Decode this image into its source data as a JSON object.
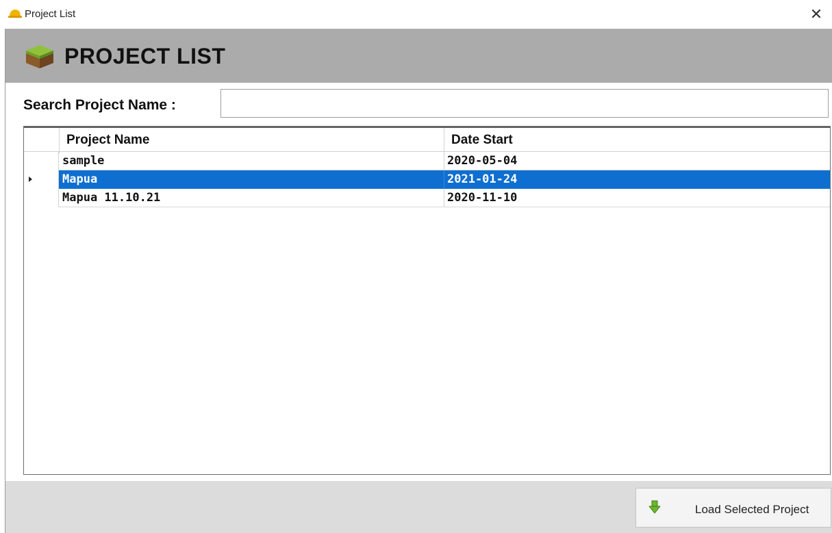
{
  "window": {
    "title": "Project List",
    "close_glyph": "✕"
  },
  "banner": {
    "title": "PROJECT LIST"
  },
  "search": {
    "label": "Search Project Name :",
    "value": "",
    "placeholder": ""
  },
  "grid": {
    "columns": [
      "Project Name",
      "Date Start"
    ],
    "rows": [
      {
        "name": "sample",
        "date": "2020-05-04",
        "selected": false
      },
      {
        "name": "Mapua",
        "date": "2021-01-24",
        "selected": true
      },
      {
        "name": "Mapua 11.10.21",
        "date": "2020-11-10",
        "selected": false
      }
    ]
  },
  "footer": {
    "load_button_label": "Load Selected Project"
  },
  "icons": {
    "title_icon": "hard-hat-icon",
    "banner_icon": "terrain-block-icon",
    "load_icon": "down-arrow-icon",
    "close_icon": "close-icon"
  },
  "colors": {
    "banner_bg": "#ababab",
    "selection": "#0f6fd0",
    "footer_bg": "#dcdcdc",
    "arrow_green": "#6cb82a"
  }
}
